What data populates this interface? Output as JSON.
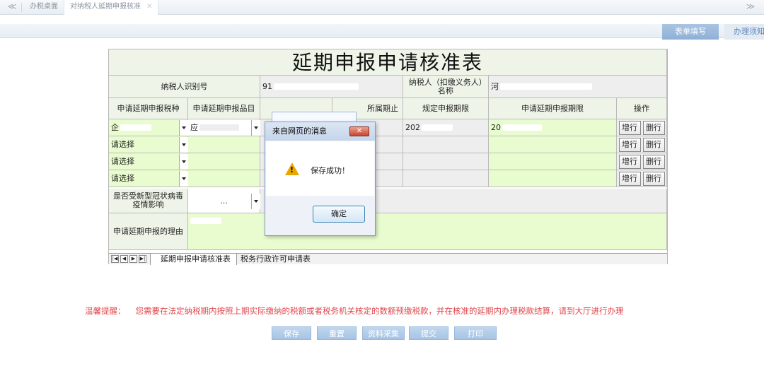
{
  "tabbar": {
    "back_glyph": "≪",
    "forward_glyph": "≫",
    "tabs": [
      {
        "label": "办税桌面",
        "close": ""
      },
      {
        "label": "对纳税人延期申报核准",
        "close": "✕"
      }
    ]
  },
  "right_tabs": {
    "active": "表单填写",
    "other": "办理须知"
  },
  "form": {
    "title": "延期申报申请核准表",
    "taxpayer_id_label": "纳税人识别号",
    "taxpayer_id_value": "91",
    "taxpayer_name_label": "纳税人（扣缴义务人）名称",
    "taxpayer_name_value": "河",
    "columns": [
      "申请延期申报税种",
      "申请延期申报品目",
      "",
      "所属期止",
      "规定申报期限",
      "申请延期申报期限",
      "操作"
    ],
    "rows": [
      {
        "tax_type": "企",
        "item": "应",
        "col3": "",
        "period_end": "",
        "deadline": "202",
        "extended": "20",
        "add": "增行",
        "delete": "删行"
      },
      {
        "tax_type": "请选择",
        "item": "",
        "col3": "",
        "period_end": "",
        "deadline": "",
        "extended": "",
        "add": "增行",
        "delete": "删行"
      },
      {
        "tax_type": "请选择",
        "item": "",
        "col3": "",
        "period_end": "",
        "deadline": "",
        "extended": "",
        "add": "增行",
        "delete": "删行"
      },
      {
        "tax_type": "请选择",
        "item": "",
        "col3": "",
        "period_end": "",
        "deadline": "",
        "extended": "",
        "add": "增行",
        "delete": "删行"
      }
    ],
    "covid_label": "是否受新型冠状病毒疫情影响",
    "covid_value": "...",
    "reason_label": "申请延期申报的理由",
    "reason_value": ""
  },
  "sheet_tabs": [
    "延期申报申请核准表",
    "税务行政许可申请表"
  ],
  "sheet_nav": [
    "|◀",
    "◀",
    "▶",
    "▶|"
  ],
  "tip": {
    "label": "温馨提醒：",
    "text": "您需要在法定纳税期内按照上期实际缴纳的税额或者税务机关核定的数额预缴税款，并在核准的延期内办理税款结算，请到大厅进行办理"
  },
  "actions": [
    "保存",
    "重置",
    "资料采集",
    "提交",
    "打印"
  ],
  "dialog": {
    "title": "来自网页的消息",
    "close": "✕",
    "icon": "!",
    "message": "保存成功！",
    "ok": "确定"
  },
  "colors": {
    "tip": "#e0454b",
    "action_button": "#a7c4e4",
    "row_green": "#e9fccf",
    "header_green": "#eef5e8"
  }
}
